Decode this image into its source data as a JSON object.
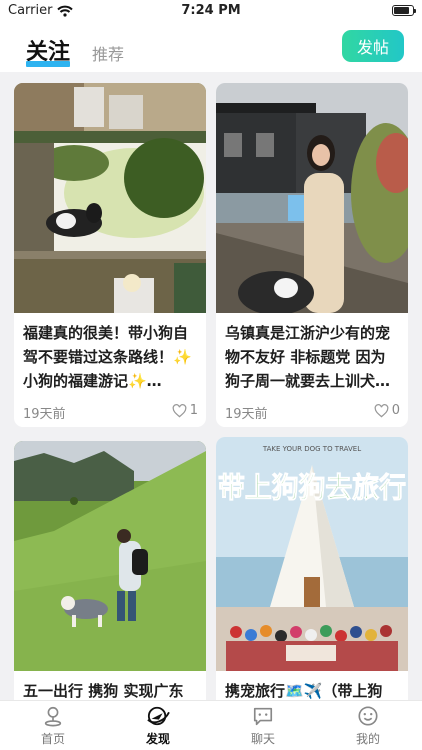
{
  "status_bar": {
    "carrier": "Carrier",
    "time": "7:24 PM"
  },
  "header": {
    "tabs": [
      {
        "label": "关注"
      },
      {
        "label": "推荐"
      }
    ],
    "post_button": "发帖"
  },
  "posts": [
    {
      "title": "福建真的很美！带小狗自驾不要错过这条路线！✨小狗的福建游记✨…",
      "time": "19天前",
      "likes": "1"
    },
    {
      "title": "乌镇真是江浙沪少有的宠物不友好 非标题党 因为狗子周一就要去上训犬…",
      "time": "19天前",
      "likes": "0"
    },
    {
      "title": "五一出行 携狗 实现广东",
      "time": "",
      "likes": ""
    },
    {
      "title": "携宠旅行🗺️✈️（带上狗",
      "image_text": "带上狗狗去旅行",
      "image_small_text": "TAKE YOUR DOG TO TRAVEL",
      "time": "",
      "likes": ""
    }
  ],
  "tab_bar": [
    {
      "label": "首页",
      "icon": "home-pin-icon"
    },
    {
      "label": "发现",
      "icon": "discover-icon"
    },
    {
      "label": "聊天",
      "icon": "chat-icon"
    },
    {
      "label": "我的",
      "icon": "profile-smile-icon"
    }
  ],
  "colors": {
    "accent": "#2eb3f0",
    "post_button": "#2bd0aa"
  }
}
